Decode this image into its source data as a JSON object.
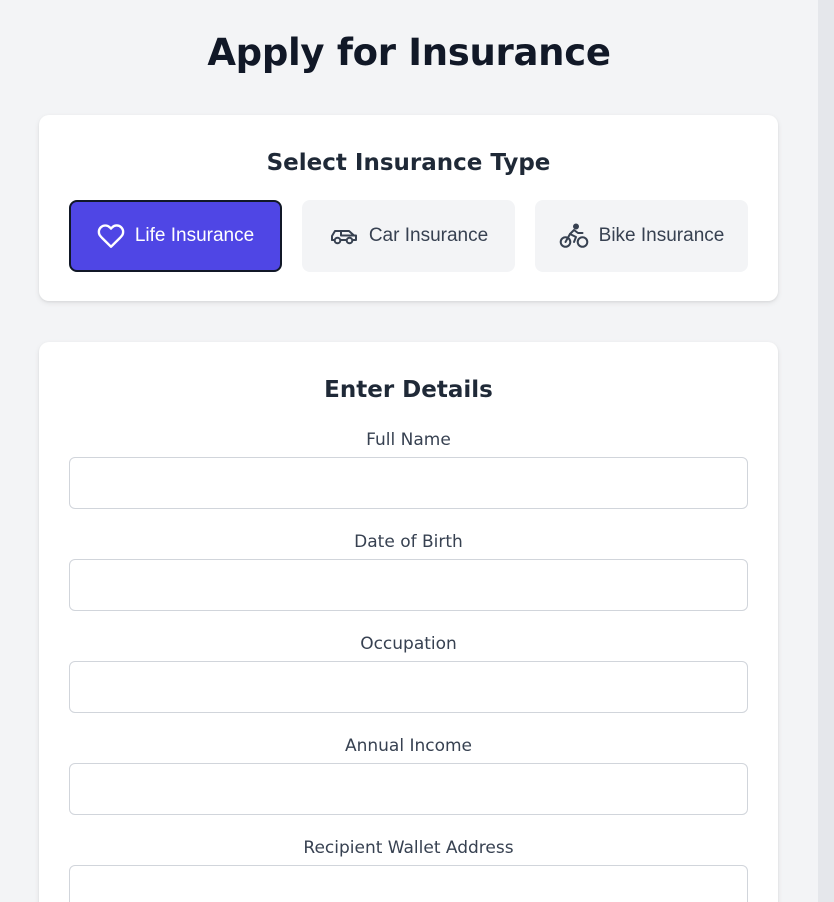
{
  "page": {
    "title": "Apply for Insurance"
  },
  "insurance_type": {
    "heading": "Select Insurance Type",
    "options": [
      {
        "label": "Life Insurance",
        "icon": "heart-icon",
        "selected": true
      },
      {
        "label": "Car Insurance",
        "icon": "car-icon",
        "selected": false
      },
      {
        "label": "Bike Insurance",
        "icon": "bicycle-icon",
        "selected": false
      }
    ]
  },
  "details": {
    "heading": "Enter Details",
    "fields": [
      {
        "label": "Full Name",
        "value": ""
      },
      {
        "label": "Date of Birth",
        "value": ""
      },
      {
        "label": "Occupation",
        "value": ""
      },
      {
        "label": "Annual Income",
        "value": ""
      },
      {
        "label": "Recipient Wallet Address",
        "value": ""
      }
    ]
  },
  "colors": {
    "background": "#f3f4f6",
    "card": "#ffffff",
    "accent": "#4f46e5",
    "text_dark": "#111827",
    "input_border": "#d1d5db"
  }
}
